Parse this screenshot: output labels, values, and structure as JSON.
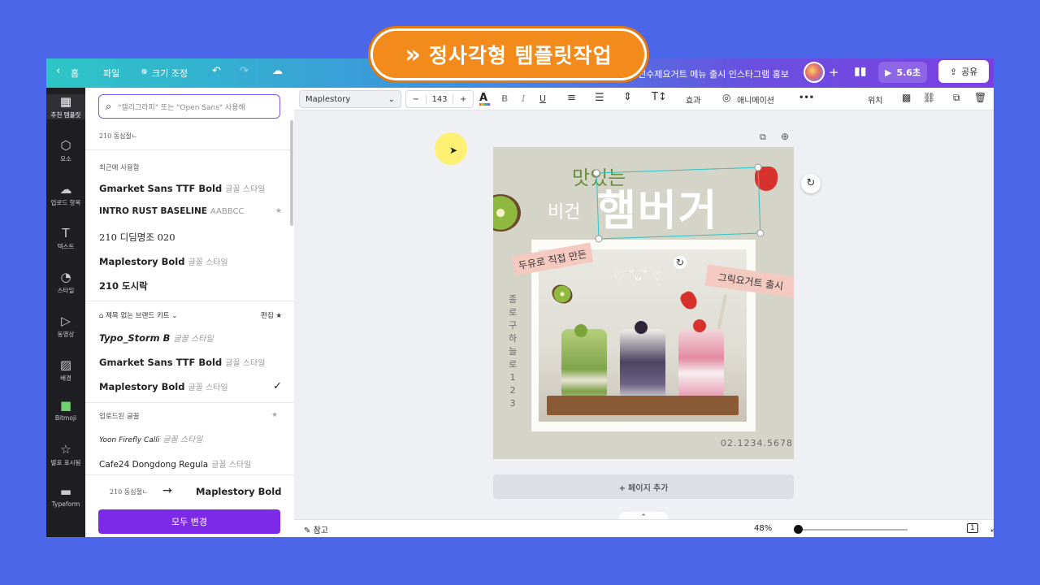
{
  "banner": {
    "text": "정사각형 템플릿작업"
  },
  "topbar": {
    "back_label": "홈",
    "file_label": "파일",
    "resize_label": "크기 조정",
    "project_title": "선수제요거트 메뉴 출시 인스타그램 홍보",
    "play_label": "5.6초",
    "share_label": "공유"
  },
  "rail": {
    "items": [
      {
        "label": "추천 템플릿",
        "icon": "template-icon"
      },
      {
        "label": "요소",
        "icon": "elements-icon"
      },
      {
        "label": "업로드 항목",
        "icon": "upload-icon"
      },
      {
        "label": "텍스트",
        "icon": "text-icon"
      },
      {
        "label": "스타일",
        "icon": "palette-icon"
      },
      {
        "label": "동영상",
        "icon": "video-icon"
      },
      {
        "label": "배경",
        "icon": "background-icon"
      },
      {
        "label": "Bitmoji",
        "icon": "bitmoji-icon"
      },
      {
        "label": "별표 표시됨",
        "icon": "star-icon"
      },
      {
        "label": "Typeform",
        "icon": "typeform-icon"
      }
    ]
  },
  "panel": {
    "search_placeholder": "\"캘리그라피\" 또는 \"Open Sans\" 사용해",
    "current_font_preview": "210 동심절ㄴ",
    "recent_title": "최근에 사용함",
    "recent_fonts": [
      {
        "name": "Gmarket Sans TTF Bold",
        "style": "글꼴 스타일"
      },
      {
        "name": "INTRO RUST BASELINE",
        "style": "AABBCC"
      },
      {
        "name": "210 디딤명조 020",
        "style": ""
      },
      {
        "name": "Maplestory Bold",
        "style": "글꼴 스타일"
      },
      {
        "name": "210 도시락",
        "style": ""
      }
    ],
    "brand_title": "제목 없는 브랜드 키트",
    "brand_edit": "편집",
    "brand_fonts": [
      {
        "name": "Typo_Storm B",
        "style": "글꼴 스타일"
      },
      {
        "name": "Gmarket Sans TTF Bold",
        "style": "글꼴 스타일"
      },
      {
        "name": "Maplestory Bold",
        "style": "글꼴 스타일"
      }
    ],
    "uploaded_title": "업로드된 글꼴",
    "uploaded_fonts": [
      {
        "name": "Yoon Firefly Calli",
        "style": "글꼴 스타일"
      },
      {
        "name": "Cafe24 Dongdong Regula",
        "style": "글꼴 스타일"
      }
    ],
    "change_from": "210 동심절ㄴ",
    "change_to": "Maplestory Bold",
    "change_all_label": "모두 변경"
  },
  "toolbar": {
    "font": "Maplestory",
    "size": "143",
    "minus": "−",
    "plus": "+",
    "bold": "B",
    "italic": "I",
    "underline": "U",
    "effects": "효과",
    "animate": "애니메이션",
    "more": "•••",
    "position": "위치"
  },
  "canvas": {
    "line1": "맛있는",
    "line2": "비건",
    "headline": "햄버거",
    "tag1": "두유로 직접 만든",
    "tag2": "그릭요거트 출시",
    "faces": "♡ ˘ᴗ˘ ♡",
    "vertical_text": "종로구하늘로123",
    "phone": "02.1234.5678",
    "add_page": "+ 페이지 추가"
  },
  "footer": {
    "notes_label": "참고",
    "zoom": "48%",
    "page_count": "1"
  },
  "colors": {
    "accent": "#7d2ae8",
    "banner": "#f28b1c",
    "selection": "#2ec4c4"
  }
}
